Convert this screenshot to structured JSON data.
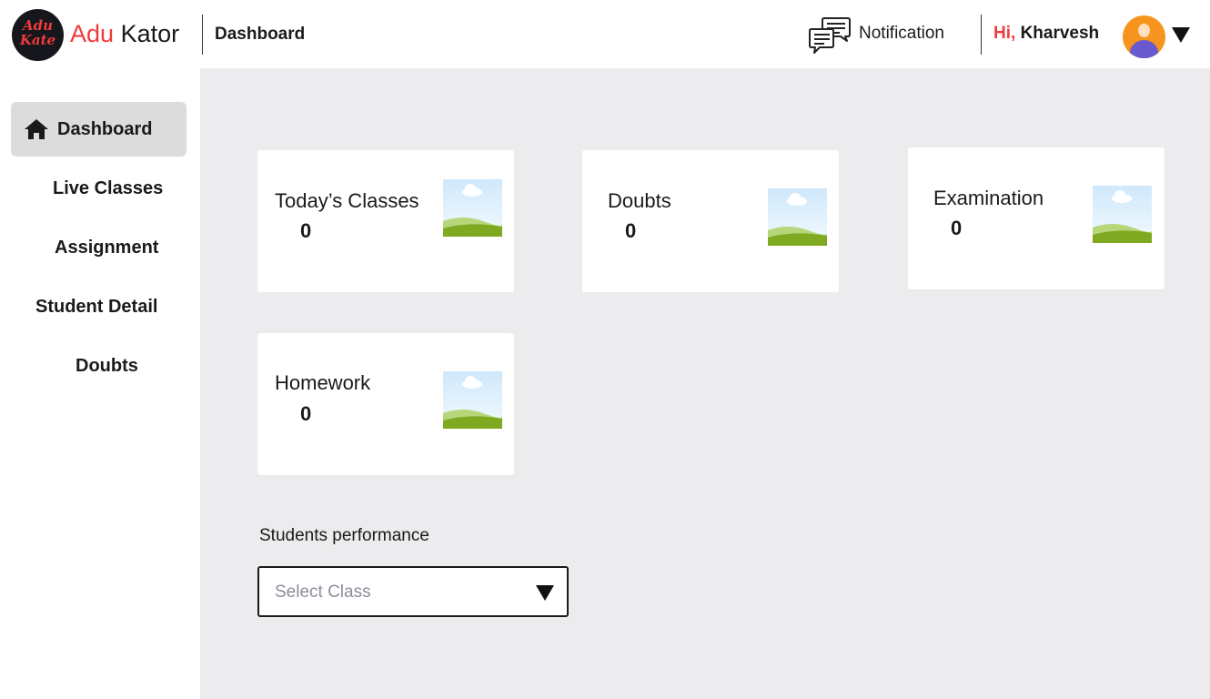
{
  "header": {
    "logo_text": [
      "Adu",
      "Kate"
    ],
    "brand_part1": "Adu",
    "brand_part2": "Kator",
    "page_title": "Dashboard",
    "notification_label": "Notification",
    "greeting_prefix": "Hi,",
    "user_name": "Kharvesh"
  },
  "sidebar": {
    "items": [
      {
        "label": "Dashboard",
        "icon": "home-icon",
        "active": true
      },
      {
        "label": "Live Classes"
      },
      {
        "label": "Assignment"
      },
      {
        "label": "Student Detail"
      },
      {
        "label": "Doubts"
      }
    ]
  },
  "cards": [
    {
      "title": "Today’s Classes",
      "value": "0",
      "image": "image-placeholder-icon"
    },
    {
      "title": "Doubts",
      "value": "0",
      "image": "image-placeholder-icon"
    },
    {
      "title": "Examination",
      "value": "0",
      "image": "image-placeholder-icon"
    },
    {
      "title": "Homework",
      "value": "0",
      "image": "image-placeholder-icon"
    }
  ],
  "performance": {
    "label": "Students performance",
    "select_placeholder": "Select Class"
  },
  "colors": {
    "brand_red": "#ef3b3b",
    "sidebar_active_bg": "#dcdcdc",
    "main_bg": "#ececee",
    "avatar_orange": "#f7941d"
  }
}
